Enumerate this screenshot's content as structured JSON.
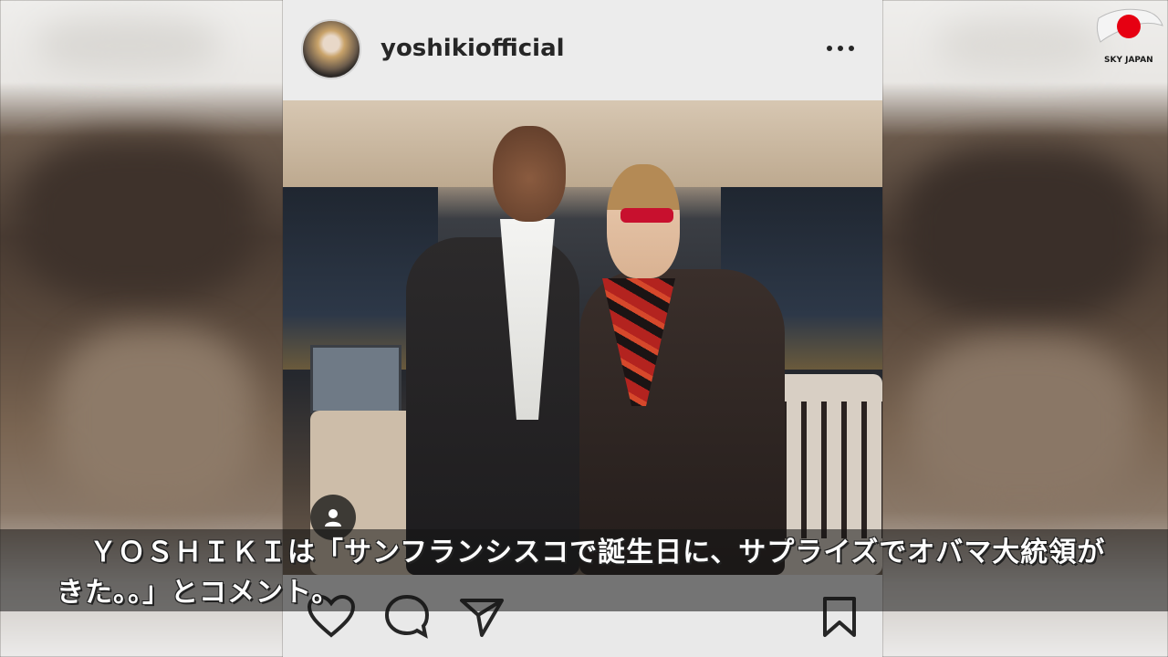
{
  "post": {
    "username": "yoshikiofficial",
    "more_icon": "more-horizontal-icon",
    "photo_subject": "",
    "tag_icon": "user-tag-icon"
  },
  "actions": {
    "like_icon": "heart-icon",
    "comment_icon": "comment-icon",
    "share_icon": "send-icon",
    "save_icon": "bookmark-icon"
  },
  "logo": {
    "text": "SKY JAPAN",
    "flag_color": "#e60012"
  },
  "caption": {
    "text": "ＹＯＳＨＩＫＩは「サンフランシスコで誕生日に、サプライズでオバマ大統領がきた。。」とコメント。"
  }
}
